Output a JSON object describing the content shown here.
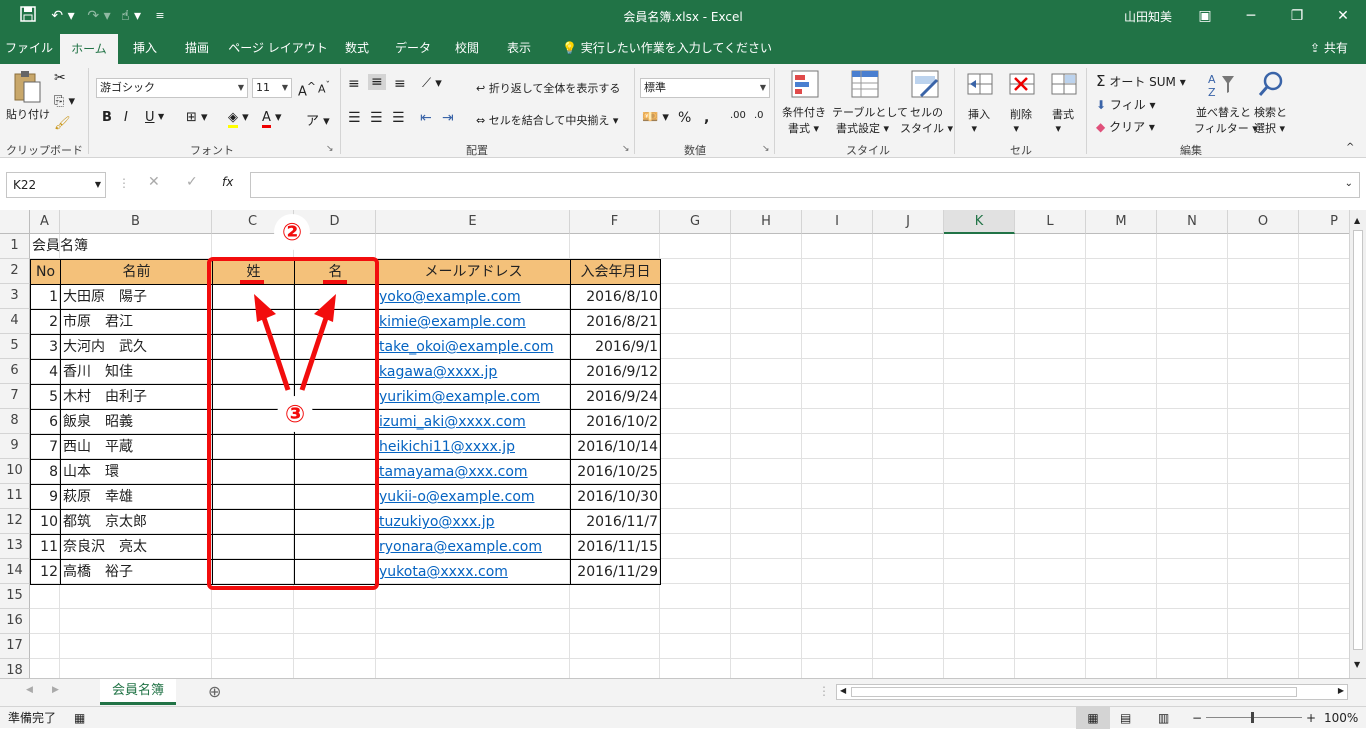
{
  "titlebar": {
    "doc_title": "会員名簿.xlsx  -  Excel",
    "user": "山田知美",
    "icons": [
      "save-icon",
      "undo-icon",
      "redo-icon",
      "touch-mode-icon",
      "customize-icon"
    ]
  },
  "tabs": [
    {
      "label": "ファイル"
    },
    {
      "label": "ホーム"
    },
    {
      "label": "挿入"
    },
    {
      "label": "描画"
    },
    {
      "label": "ページ レイアウト"
    },
    {
      "label": "数式"
    },
    {
      "label": "データ"
    },
    {
      "label": "校閲"
    },
    {
      "label": "表示"
    }
  ],
  "tellme": "実行したい作業を入力してください",
  "share": "共有",
  "ribbon": {
    "clipboard": {
      "label": "クリップボード",
      "paste": "貼り付け"
    },
    "font": {
      "label": "フォント",
      "font_name": "游ゴシック",
      "font_size": "11",
      "bold": "B",
      "italic": "I",
      "underline": "U",
      "grow": "A",
      "shrink": "A"
    },
    "alignment": {
      "label": "配置",
      "wrap": "折り返して全体を表示する",
      "merge": "セルを結合して中央揃え"
    },
    "number": {
      "label": "数値",
      "format": "標準",
      "percent": "%",
      "comma": ","
    },
    "styles": {
      "label": "スタイル",
      "cond1": "条件付き",
      "cond2": "書式",
      "table1": "テーブルとして",
      "table2": "書式設定",
      "cell1": "セルの",
      "cell2": "スタイル"
    },
    "cells": {
      "label": "セル",
      "insert": "挿入",
      "delete": "削除",
      "format": "書式"
    },
    "editing": {
      "label": "編集",
      "autosum": "オート SUM",
      "fill": "フィル",
      "clear": "クリア",
      "sort1": "並べ替えと",
      "sort2": "フィルター",
      "find1": "検索と",
      "find2": "選択"
    }
  },
  "formula_bar": {
    "name_box": "K22",
    "fx": "fx",
    "value": ""
  },
  "columns": [
    "A",
    "B",
    "C",
    "D",
    "E",
    "F",
    "G",
    "H",
    "I",
    "J",
    "K",
    "L",
    "M",
    "N",
    "O",
    "P"
  ],
  "selected_column": "K",
  "rows": [
    "1",
    "2",
    "3",
    "4",
    "5",
    "6",
    "7",
    "8",
    "9",
    "10",
    "11",
    "12",
    "13",
    "14",
    "15",
    "16",
    "17",
    "18"
  ],
  "sheet": {
    "title": "会員名簿",
    "headers": {
      "no": "No",
      "name": "名前",
      "sei": "姓",
      "mei": "名",
      "email": "メールアドレス",
      "date": "入会年月日"
    },
    "records": [
      {
        "no": "1",
        "name": "大田原　陽子",
        "email": "yoko@example.com",
        "date": "2016/8/10"
      },
      {
        "no": "2",
        "name": "市原　君江",
        "email": "kimie@example.com",
        "date": "2016/8/21"
      },
      {
        "no": "3",
        "name": "大河内　武久",
        "email": "take_okoi@example.com",
        "date": "2016/9/1"
      },
      {
        "no": "4",
        "name": "香川　知佳",
        "email": "kagawa@xxxx.jp",
        "date": "2016/9/12"
      },
      {
        "no": "5",
        "name": "木村　由利子",
        "email": "yurikim@example.com",
        "date": "2016/9/24"
      },
      {
        "no": "6",
        "name": "飯泉　昭義",
        "email": "izumi_aki@xxxx.com",
        "date": "2016/10/2"
      },
      {
        "no": "7",
        "name": "西山　平蔵",
        "email": "heikichi11@xxxx.jp",
        "date": "2016/10/14"
      },
      {
        "no": "8",
        "name": "山本　環",
        "email": "tamayama@xxx.com",
        "date": "2016/10/25"
      },
      {
        "no": "9",
        "name": "萩原　幸雄",
        "email": "yukii-o@example.com",
        "date": "2016/10/30"
      },
      {
        "no": "10",
        "name": "都筑　京太郎",
        "email": "tuzukiyo@xxx.jp",
        "date": "2016/11/7"
      },
      {
        "no": "11",
        "name": "奈良沢　亮太",
        "email": "ryonara@example.com",
        "date": "2016/11/15"
      },
      {
        "no": "12",
        "name": "高橋　裕子",
        "email": "yukota@xxxx.com",
        "date": "2016/11/29"
      }
    ]
  },
  "annotations": {
    "step2": "②",
    "step3": "③",
    "color": "#f20d0d"
  },
  "sheet_tab": "会員名簿",
  "status": {
    "ready": "準備完了",
    "zoom": "100%"
  },
  "colors": {
    "accent": "#217346",
    "header_fill": "#f4c17a",
    "link": "#0563c1"
  }
}
